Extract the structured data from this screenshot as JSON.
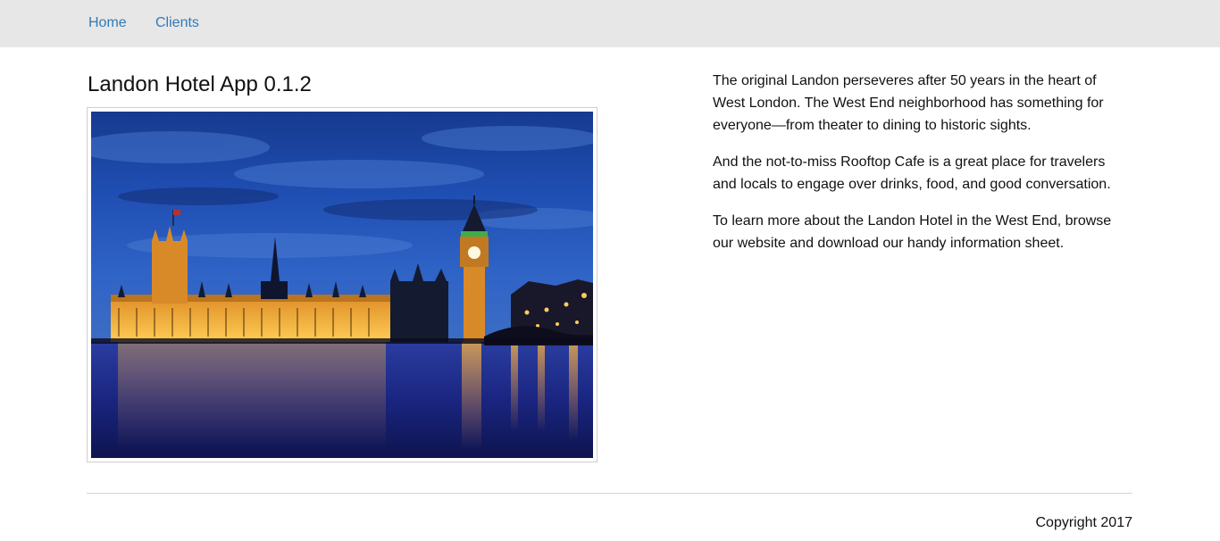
{
  "nav": {
    "items": [
      {
        "label": "Home"
      },
      {
        "label": "Clients"
      }
    ]
  },
  "main": {
    "title": "Landon Hotel App 0.1.2",
    "image_subject": "Houses of Parliament and Big Ben at dusk",
    "paragraphs": [
      "The original Landon perseveres after 50 years in the heart of West London. The West End neighborhood has something for everyone—from theater to dining to historic sights.",
      "And the not-to-miss Rooftop Cafe is a great place for travelers and locals to engage over drinks, food, and good conversation.",
      "To learn more about the Landon Hotel in the West End, browse our website and download our handy information sheet."
    ]
  },
  "footer": {
    "copyright": "Copyright 2017"
  },
  "colors": {
    "navbar_bg": "#e7e7e7",
    "link": "#337ab7",
    "divider": "#d5d5d5"
  }
}
